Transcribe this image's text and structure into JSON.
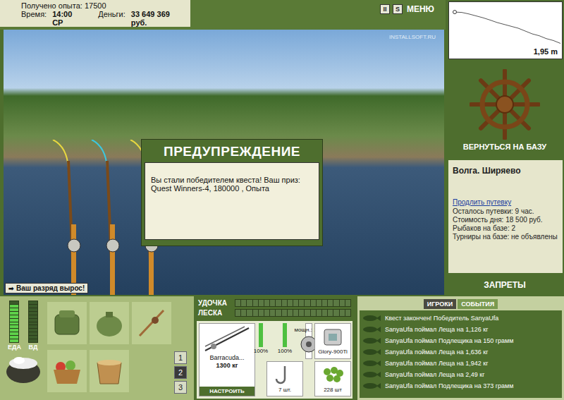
{
  "top_bar": {
    "experience": "Получено опыта: 17500",
    "time_label": "Время:",
    "time": "14:00 СР",
    "money_label": "Деньги:",
    "money": "33 649 369 руб.",
    "buttons": [
      "II",
      "S",
      "МЕНЮ"
    ]
  },
  "scene": {
    "watermark": "INSTALLSOFT.RU",
    "rods": [
      {
        "line_color": "#e8d840"
      },
      {
        "line_color": "#3cc8e0"
      },
      {
        "line_color": "#e8d840"
      }
    ],
    "rank_badge": {
      "icon": "➡",
      "text": "Ваш разряд вырос!"
    }
  },
  "dialog": {
    "title": "ПРЕДУПРЕЖДЕНИЕ",
    "message": "Вы стали победителем квеста! Ваш приз: Quest Winners-4, 180000 , Опыта"
  },
  "depth_chart": {
    "values": [
      0.3,
      0.32,
      0.4,
      0.5,
      0.6,
      0.72,
      0.85,
      0.95,
      1.05,
      1.15,
      1.3,
      1.45,
      1.55,
      1.7,
      1.8,
      1.95
    ],
    "reading": "1,95 m"
  },
  "base": {
    "button": "ВЕРНУТЬСЯ НА БАЗУ",
    "location": "Волга. Ширяево",
    "extend_link": "Продлить путевку",
    "info": [
      "Осталось путевки: 9 час.",
      "Стоимость дня: 18 500 руб.",
      "Рыбаков на базе: 2",
      "Турниры на базе: не объявлены"
    ],
    "bans": "ЗАПРЕТЫ"
  },
  "needs": [
    {
      "label": "ЕДА",
      "level": 0.9
    },
    {
      "label": "ВД",
      "level": 0
    }
  ],
  "slots": [
    {
      "label": "1",
      "selected": false
    },
    {
      "label": "2",
      "selected": true
    },
    {
      "label": "3",
      "selected": false
    }
  ],
  "tension": [
    {
      "label": "УДОЧКА",
      "level": 0
    },
    {
      "label": "ЛЕСКА",
      "level": 0
    }
  ],
  "tackle": {
    "rod": {
      "name": "Barracuda...",
      "test": "1300 кг",
      "condition": "100%",
      "level": 1,
      "button": "НАСТРОИТЬ"
    },
    "reel": {
      "power": "мощн.: 180",
      "condition": "100%",
      "level": 1
    },
    "line": {
      "name": "Glory-900Ti"
    },
    "hook": {
      "count": "7 шт."
    },
    "bait": {
      "count": "228 шт"
    }
  },
  "chat": {
    "tabs": [
      {
        "label": "ИГРОКИ",
        "selected": true
      },
      {
        "label": "СОБЫТИЯ",
        "selected": false
      }
    ],
    "messages": [
      "Квест закончен! Победитель SanyaUfa",
      "SanyaUfa поймал Леща на 1,126 кг",
      "SanyaUfa поймал Подлещика на 150 грамм",
      "SanyaUfa поймал Леща на 1,636 кг",
      "SanyaUfa поймал Леща на 1,942 кг",
      "SanyaUfa поймал Леща на 2,49 кг",
      "SanyaUfa поймал Подлещика на 373 грамм"
    ]
  }
}
